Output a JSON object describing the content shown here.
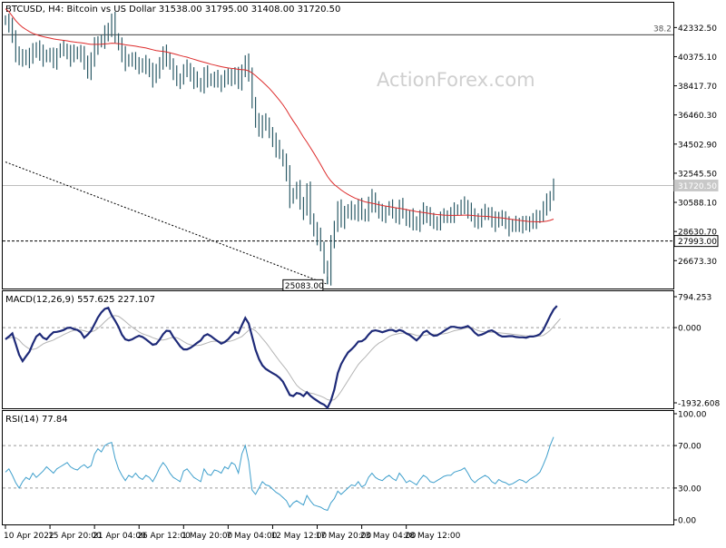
{
  "chart_data": {
    "type": "line",
    "panels": {
      "price": {
        "header": "BTCUSD, H4:  Bitcoin vs US Dollar  31538.00 31795.00 31408.00 31720.50",
        "watermark": "ActionForex.com",
        "ylim": [
          24800,
          44000
        ],
        "y_ticks": [
          "42332.50",
          "40375.10",
          "38417.70",
          "36460.30",
          "34502.90",
          "32545.50",
          "30588.10",
          "28630.70",
          "26673.30"
        ],
        "fib_level": {
          "label": "38.2",
          "value": 41850
        },
        "current_price": {
          "label": "31720.50",
          "value": 31720.5
        },
        "support": {
          "label": "27993.00",
          "value": 27993
        },
        "low_marker": {
          "label": "25083.00",
          "value": 25083,
          "index": 94
        },
        "trendline": {
          "from": {
            "index": 0,
            "value": 33300
          },
          "to": {
            "index": 94,
            "value": 25083
          }
        },
        "series": [
          {
            "name": "Price",
            "color": "#2b5a66",
            "values": [
              42800,
              42400,
              41800,
              40600,
              40100,
              40300,
              40500,
              40200,
              40700,
              41000,
              40600,
              40300,
              40500,
              40400,
              40100,
              40600,
              40800,
              40900,
              40700,
              40300,
              40600,
              40700,
              40500,
              40100,
              39200,
              40200,
              41100,
              41400,
              41300,
              41900,
              42300,
              42800,
              41600,
              41200,
              40500,
              40000,
              40200,
              40100,
              40000,
              39800,
              39600,
              39900,
              39500,
              38900,
              39300,
              40000,
              40600,
              40300,
              39800,
              39200,
              38900,
              38800,
              39400,
              39600,
              39200,
              38800,
              38600,
              38400,
              39200,
              38900,
              38700,
              38900,
              38800,
              38600,
              39000,
              38900,
              39200,
              39100,
              38500,
              39500,
              40000,
              39300,
              37200,
              36000,
              35500,
              36100,
              35700,
              35300,
              34800,
              34200,
              33800,
              33400,
              32500,
              30800,
              31200,
              31500,
              30600,
              30000,
              31400,
              29500,
              28800,
              28300,
              27600,
              26200,
              25600,
              27800,
              29000,
              30200,
              29400,
              30000,
              29800,
              30100,
              29900,
              30300,
              29700,
              29800,
              30500,
              30900,
              30200,
              29900,
              29800,
              30000,
              30200,
              29900,
              29700,
              30300,
              29800,
              29400,
              29600,
              29300,
              29000,
              29600,
              30000,
              29800,
              29300,
              29200,
              29300,
              29500,
              29600,
              29700,
              29800,
              30000,
              30100,
              30300,
              30400,
              30100,
              29600,
              29300,
              29500,
              29700,
              29900,
              29800,
              29400,
              29200,
              29600,
              29400,
              29300,
              28900,
              29000,
              29100,
              29200,
              29100,
              29000,
              29300,
              29400,
              29500,
              29700,
              30200,
              30600,
              31000,
              31720
            ]
          },
          {
            "name": "MA",
            "color": "#dd2b2b",
            "values": [
              43600,
              43400,
              43100,
              42800,
              42550,
              42350,
              42200,
              42060,
              41940,
              41860,
              41780,
              41720,
              41670,
              41620,
              41570,
              41530,
              41500,
              41470,
              41440,
              41400,
              41360,
              41330,
              41310,
              41280,
              41230,
              41200,
              41200,
              41200,
              41210,
              41230,
              41250,
              41280,
              41270,
              41250,
              41220,
              41170,
              41140,
              41110,
              41080,
              41040,
              41000,
              40960,
              40900,
              40840,
              40790,
              40760,
              40730,
              40690,
              40640,
              40580,
              40520,
              40450,
              40390,
              40340,
              40270,
              40200,
              40130,
              40060,
              40000,
              39940,
              39870,
              39810,
              39760,
              39700,
              39660,
              39620,
              39590,
              39570,
              39520,
              39500,
              39490,
              39420,
              39280,
              39100,
              38900,
              38700,
              38480,
              38250,
              38000,
              37730,
              37440,
              37140,
              36800,
              36420,
              36060,
              35720,
              35350,
              34970,
              34640,
              34270,
              33900,
              33520,
              33130,
              32720,
              32330,
              32030,
              31780,
              31600,
              31420,
              31260,
              31120,
              30990,
              30880,
              30790,
              30700,
              30620,
              30570,
              30530,
              30480,
              30430,
              30380,
              30340,
              30300,
              30260,
              30220,
              30190,
              30150,
              30100,
              30060,
              30020,
              29970,
              29930,
              29900,
              29870,
              29830,
              29800,
              29770,
              29750,
              29730,
              29720,
              29710,
              29710,
              29710,
              29720,
              29730,
              29730,
              29710,
              29690,
              29670,
              29660,
              29650,
              29640,
              29610,
              29580,
              29560,
              29540,
              29510,
              29470,
              29440,
              29410,
              29380,
              29350,
              29320,
              29300,
              29290,
              29280,
              29280,
              29300,
              29330,
              29380,
              29460
            ]
          }
        ]
      },
      "macd": {
        "label": "MACD(12,26,9) 557.625 227.107",
        "ylim": [
          -1932.608,
          794.253
        ],
        "y_ticks": [
          "794.253",
          "0.000",
          "-1932.608"
        ],
        "series": [
          {
            "name": "MACD",
            "color": "#1e2a78",
            "values": [
              -300,
              -230,
              -150,
              -420,
              -700,
              -860,
              -740,
              -620,
              -410,
              -230,
              -160,
              -260,
              -300,
              -200,
              -120,
              -110,
              -90,
              -60,
              -10,
              0,
              -40,
              -60,
              -120,
              -260,
              -180,
              -80,
              90,
              260,
              390,
              480,
              510,
              320,
              180,
              20,
              -180,
              -300,
              -330,
              -300,
              -250,
              -210,
              -240,
              -300,
              -370,
              -440,
              -420,
              -310,
              -170,
              -80,
              -90,
              -240,
              -360,
              -480,
              -560,
              -560,
              -520,
              -460,
              -390,
              -330,
              -210,
              -170,
              -220,
              -290,
              -350,
              -410,
              -370,
              -300,
              -200,
              -110,
              -140,
              60,
              250,
              110,
              -230,
              -570,
              -810,
              -970,
              -1060,
              -1120,
              -1170,
              -1220,
              -1290,
              -1390,
              -1560,
              -1730,
              -1760,
              -1680,
              -1700,
              -1760,
              -1660,
              -1750,
              -1820,
              -1880,
              -1940,
              -1980,
              -2060,
              -1880,
              -1590,
              -1170,
              -940,
              -780,
              -640,
              -560,
              -470,
              -360,
              -350,
              -290,
              -180,
              -90,
              -70,
              -90,
              -120,
              -90,
              -60,
              -60,
              -100,
              -60,
              -90,
              -150,
              -190,
              -260,
              -330,
              -240,
              -120,
              -80,
              -160,
              -210,
              -200,
              -150,
              -90,
              -30,
              20,
              20,
              0,
              -10,
              10,
              40,
              -30,
              -130,
              -200,
              -180,
              -140,
              -90,
              -70,
              -120,
              -190,
              -230,
              -230,
              -220,
              -220,
              -240,
              -250,
              -250,
              -260,
              -230,
              -230,
              -210,
              -170,
              -60,
              120,
              300,
              460,
              560
            ]
          },
          {
            "name": "Signal",
            "color": "#b4b4b4",
            "values": [
              -280,
              -270,
              -250,
              -260,
              -320,
              -420,
              -490,
              -550,
              -560,
              -540,
              -480,
              -420,
              -380,
              -350,
              -320,
              -270,
              -230,
              -180,
              -140,
              -100,
              -70,
              -60,
              -60,
              -80,
              -110,
              -110,
              -80,
              -20,
              60,
              150,
              230,
              290,
              310,
              290,
              230,
              160,
              80,
              10,
              -50,
              -110,
              -160,
              -190,
              -220,
              -260,
              -290,
              -320,
              -320,
              -300,
              -270,
              -250,
              -260,
              -300,
              -360,
              -410,
              -440,
              -460,
              -460,
              -450,
              -420,
              -390,
              -360,
              -350,
              -350,
              -360,
              -370,
              -360,
              -340,
              -310,
              -270,
              -230,
              -150,
              -70,
              -30,
              -80,
              -170,
              -280,
              -380,
              -500,
              -620,
              -740,
              -860,
              -970,
              -1080,
              -1210,
              -1350,
              -1480,
              -1560,
              -1620,
              -1660,
              -1680,
              -1700,
              -1730,
              -1760,
              -1800,
              -1850,
              -1870,
              -1850,
              -1760,
              -1640,
              -1500,
              -1360,
              -1220,
              -1080,
              -950,
              -850,
              -760,
              -660,
              -560,
              -470,
              -400,
              -350,
              -290,
              -230,
              -190,
              -170,
              -150,
              -140,
              -140,
              -150,
              -170,
              -200,
              -210,
              -200,
              -190,
              -170,
              -170,
              -170,
              -170,
              -160,
              -140,
              -110,
              -80,
              -60,
              -40,
              -20,
              0,
              -10,
              -40,
              -80,
              -100,
              -110,
              -120,
              -120,
              -120,
              -130,
              -140,
              -150,
              -160,
              -170,
              -180,
              -190,
              -200,
              -210,
              -220,
              -220,
              -220,
              -220,
              -200,
              -140,
              -70,
              30,
              130,
              230
            ]
          }
        ]
      },
      "rsi": {
        "label": "RSI(14) 77.84",
        "ylim": [
          0,
          100
        ],
        "y_ticks": [
          "100.00",
          "70.00",
          "30.00",
          "0.00"
        ],
        "levels": [
          70,
          30
        ],
        "series": [
          {
            "name": "RSI",
            "color": "#3f9fcc",
            "values": [
              45,
              48,
              42,
              35,
              30,
              36,
              40,
              38,
              44,
              40,
              43,
              46,
              50,
              47,
              44,
              48,
              50,
              52,
              54,
              50,
              48,
              47,
              50,
              52,
              49,
              51,
              62,
              67,
              64,
              70,
              72,
              73,
              58,
              48,
              42,
              37,
              42,
              40,
              44,
              40,
              38,
              42,
              40,
              36,
              42,
              49,
              54,
              50,
              44,
              40,
              38,
              36,
              46,
              48,
              44,
              40,
              38,
              36,
              48,
              43,
              42,
              47,
              46,
              44,
              50,
              48,
              54,
              52,
              44,
              62,
              70,
              55,
              28,
              24,
              30,
              36,
              33,
              32,
              29,
              26,
              24,
              21,
              18,
              12,
              16,
              18,
              16,
              14,
              23,
              18,
              14,
              13,
              12,
              10,
              9,
              16,
              20,
              27,
              24,
              27,
              30,
              33,
              32,
              36,
              31,
              33,
              40,
              44,
              40,
              38,
              37,
              40,
              42,
              39,
              37,
              44,
              40,
              35,
              37,
              35,
              33,
              38,
              42,
              40,
              36,
              35,
              37,
              39,
              41,
              42,
              42,
              45,
              46,
              47,
              49,
              44,
              38,
              35,
              38,
              40,
              42,
              40,
              36,
              34,
              38,
              36,
              35,
              33,
              34,
              36,
              38,
              37,
              35,
              38,
              40,
              42,
              45,
              52,
              60,
              70,
              78
            ]
          }
        ]
      }
    },
    "x_tick_labels": [
      {
        "label": "10 Apr 2022",
        "index": 0
      },
      {
        "label": "15 Apr 20:00",
        "index": 13
      },
      {
        "label": "21 Apr 04:00",
        "index": 26
      },
      {
        "label": "26 Apr 12:00",
        "index": 39
      },
      {
        "label": "1 May 20:00",
        "index": 52
      },
      {
        "label": "7 May 04:00",
        "index": 65
      },
      {
        "label": "12 May 12:00",
        "index": 78
      },
      {
        "label": "17 May 20:00",
        "index": 91
      },
      {
        "label": "23 May 04:00",
        "index": 104
      },
      {
        "label": "28 May 12:00",
        "index": 117
      }
    ]
  }
}
